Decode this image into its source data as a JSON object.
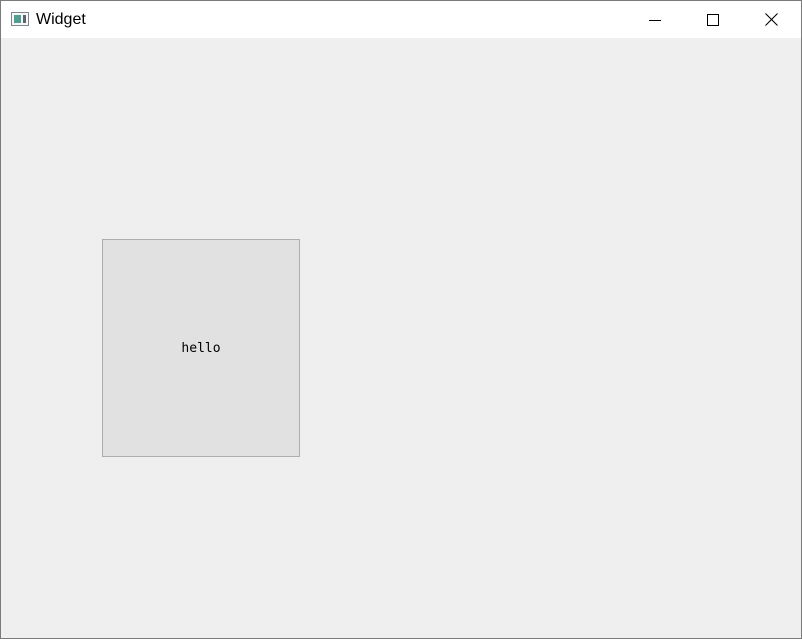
{
  "window": {
    "title": "Widget",
    "app_icon": "window-app-icon",
    "controls": {
      "minimize_icon": "minimize-icon",
      "maximize_icon": "maximize-icon",
      "close_icon": "close-icon"
    }
  },
  "content": {
    "box_label": "hello"
  },
  "colors": {
    "titlebar": "#ffffff",
    "client_background": "#efefef",
    "box_background": "#e1e1e1",
    "box_border": "#adadad"
  }
}
